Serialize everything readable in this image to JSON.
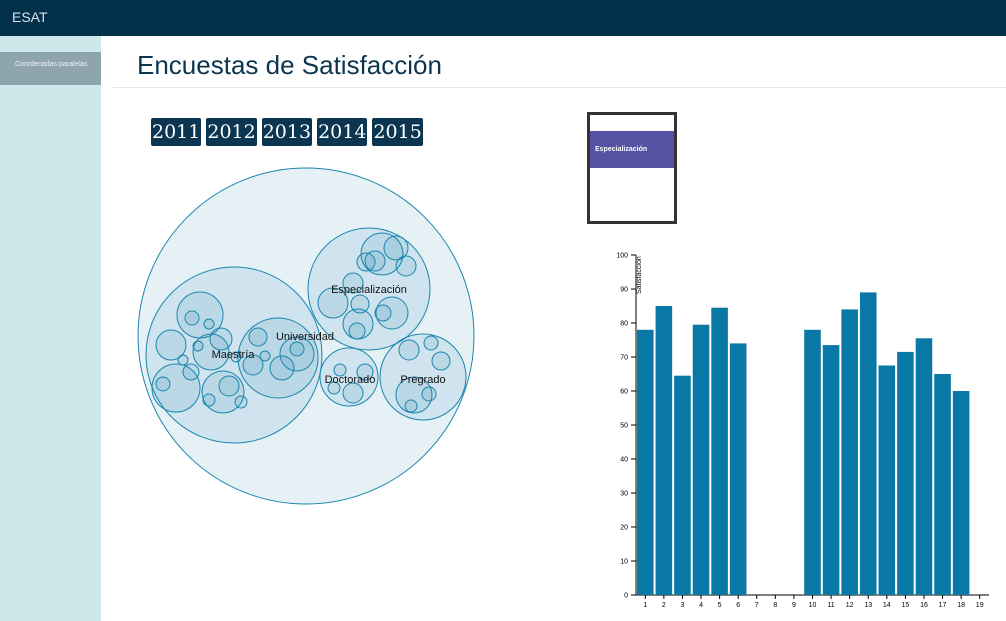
{
  "app": {
    "brand": "ESAT"
  },
  "sidebar": {
    "items": [
      {
        "label": "Coordenadas paralelas"
      }
    ]
  },
  "page": {
    "title": "Encuestas de Satisfacción"
  },
  "years": [
    "2011",
    "2012",
    "2013",
    "2014",
    "2015"
  ],
  "pack": {
    "labels": [
      "Especialización",
      "Universidad",
      "Maestría",
      "Doctorado",
      "Pregrado"
    ]
  },
  "legend": {
    "items": [
      {
        "label": "Especialización",
        "color": "#5352a3"
      }
    ]
  },
  "colors": {
    "bar": "#0a78a4",
    "nav": "#03304a",
    "sidebar": "#cde7ea"
  },
  "chart_data": {
    "type": "bar",
    "title": "",
    "xlabel": "",
    "ylabel": "Satisfacción",
    "ylim": [
      0,
      100
    ],
    "yticks": [
      0,
      10,
      20,
      30,
      40,
      50,
      60,
      70,
      80,
      90,
      100
    ],
    "categories": [
      "1",
      "2",
      "3",
      "4",
      "5",
      "6",
      "7",
      "8",
      "9",
      "10",
      "11",
      "12",
      "13",
      "14",
      "15",
      "16",
      "17",
      "18",
      "19"
    ],
    "values": [
      78,
      85,
      64.5,
      79.5,
      84.5,
      74,
      null,
      null,
      null,
      78,
      73.5,
      84,
      89,
      67.5,
      71.5,
      75.5,
      65,
      60,
      null
    ],
    "grid": false
  }
}
